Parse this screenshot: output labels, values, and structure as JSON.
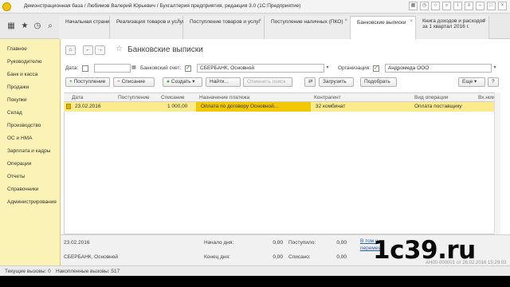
{
  "window": {
    "title": "Демонстрационная база / Любимов Валерий Юрьевич / Бухгалтерия предприятия, редакция 3.0  (1С:Предприятие)"
  },
  "tabs": [
    {
      "label": "Начальная страница"
    },
    {
      "label": "Реализация товаров и услуг"
    },
    {
      "label": "Поступление товаров и услуг"
    },
    {
      "label": "Поступление наличных (ПКО)"
    },
    {
      "label": "Банковские выписки"
    },
    {
      "label": "Книга доходов и расходов",
      "label2": "за 1 квартал 2016 г."
    }
  ],
  "sidebar": {
    "items": [
      {
        "label": "Главное"
      },
      {
        "label": "Руководителю"
      },
      {
        "label": "Банк и касса"
      },
      {
        "label": "Продажи"
      },
      {
        "label": "Покупки"
      },
      {
        "label": "Склад"
      },
      {
        "label": "Производство"
      },
      {
        "label": "ОС и НМА"
      },
      {
        "label": "Зарплата и кадры"
      },
      {
        "label": "Операции"
      },
      {
        "label": "Отчеты"
      },
      {
        "label": "Справочники"
      },
      {
        "label": "Администрирование"
      }
    ]
  },
  "page": {
    "title": "Банковские выписки"
  },
  "filters": {
    "date_label": "Дата:",
    "date_value": "",
    "account_label": "Банковский счет:",
    "account_value": "СБЕРБАНК, Основной",
    "org_label": "Организация:",
    "org_value": "Андромеда ООО"
  },
  "toolbar": {
    "receipt": "Поступление",
    "writeoff": "Списание",
    "create": "Создать",
    "find": "Найти...",
    "cancel_search": "Отменить поиск",
    "load": "Загрузить",
    "select": "Подобрать",
    "more": "Еще",
    "help": "?"
  },
  "table": {
    "columns": [
      "Дата",
      "Поступление",
      "Списание",
      "Назначение платежа",
      "Контрагент",
      "Вид операции",
      "Вх.ном"
    ],
    "rows": [
      {
        "date": "23.02.2016",
        "receipt": "",
        "writeoff": "1 000,00",
        "purpose": "Оплата по договору Основной...",
        "counterparty": "32 комбинат",
        "operation": "Оплата поставщику",
        "in_number": ""
      }
    ]
  },
  "footer": {
    "date": "23.02.2016",
    "account": "СБЕРБАНК, Основной",
    "start_label": "Начало дня:",
    "start_value": "0,00",
    "received_label": "Поступило:",
    "received_value": "0,00",
    "end_label": "Конец дня:",
    "end_value": "0,00",
    "written_label": "Списано:",
    "written_value": "0,00",
    "link_line1": "В том ч",
    "link_line2": "перемещ"
  },
  "statusbar": {
    "current_calls": "Текущие вызовы: 0",
    "accumulated_calls": "Накопленные вызовы: 517"
  },
  "watermark": {
    "brand": "1c39.ru",
    "sub": "АН00-000001 от 26.02.2016 15:29:03"
  }
}
